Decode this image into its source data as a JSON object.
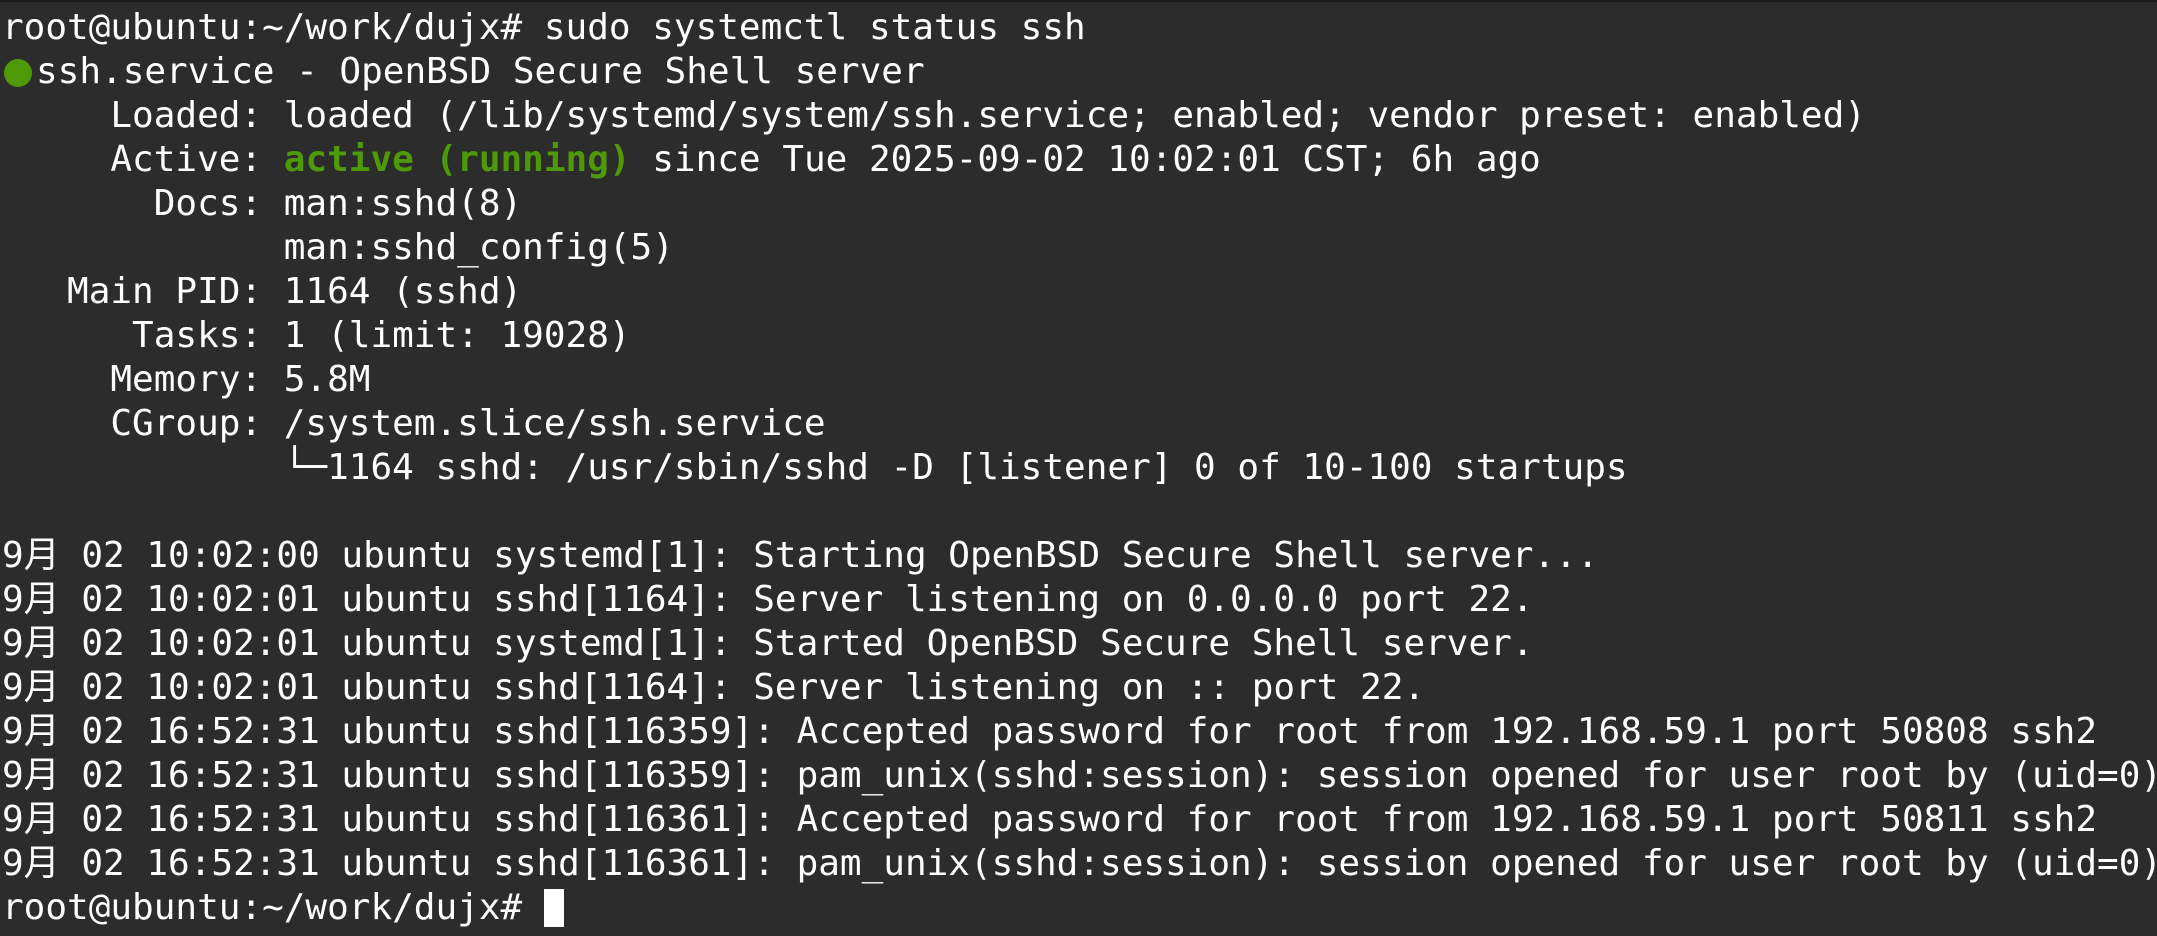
{
  "colors": {
    "background": "#2c2c2c",
    "text": "#ffffff",
    "active": "#4e9a06",
    "bullet": "#4e9a06"
  },
  "command_line": "root@ubuntu:~/work/dujx# sudo systemctl status ssh",
  "service_header": "ssh.service - OpenBSD Secure Shell server",
  "status": {
    "loaded": "     Loaded: loaded (/lib/systemd/system/ssh.service; enabled; vendor preset: enabled)",
    "active_label": "     Active: ",
    "active_state": "active (running)",
    "active_since": " since Tue 2025-09-02 10:02:01 CST; 6h ago",
    "docs_1": "       Docs: man:sshd(8)",
    "docs_2": "             man:sshd_config(5)",
    "main_pid": "   Main PID: 1164 (sshd)",
    "tasks": "      Tasks: 1 (limit: 19028)",
    "memory": "     Memory: 5.8M",
    "cgroup_1": "     CGroup: /system.slice/ssh.service",
    "cgroup_2": "             └─1164 sshd: /usr/sbin/sshd -D [listener] 0 of 10-100 startups"
  },
  "log": [
    "9月 02 10:02:00 ubuntu systemd[1]: Starting OpenBSD Secure Shell server...",
    "9月 02 10:02:01 ubuntu sshd[1164]: Server listening on 0.0.0.0 port 22.",
    "9月 02 10:02:01 ubuntu systemd[1]: Started OpenBSD Secure Shell server.",
    "9月 02 10:02:01 ubuntu sshd[1164]: Server listening on :: port 22.",
    "9月 02 16:52:31 ubuntu sshd[116359]: Accepted password for root from 192.168.59.1 port 50808 ssh2",
    "9月 02 16:52:31 ubuntu sshd[116359]: pam_unix(sshd:session): session opened for user root by (uid=0)",
    "9月 02 16:52:31 ubuntu sshd[116361]: Accepted password for root from 192.168.59.1 port 50811 ssh2",
    "9月 02 16:52:31 ubuntu sshd[116361]: pam_unix(sshd:session): session opened for user root by (uid=0)"
  ],
  "prompt": "root@ubuntu:~/work/dujx# "
}
